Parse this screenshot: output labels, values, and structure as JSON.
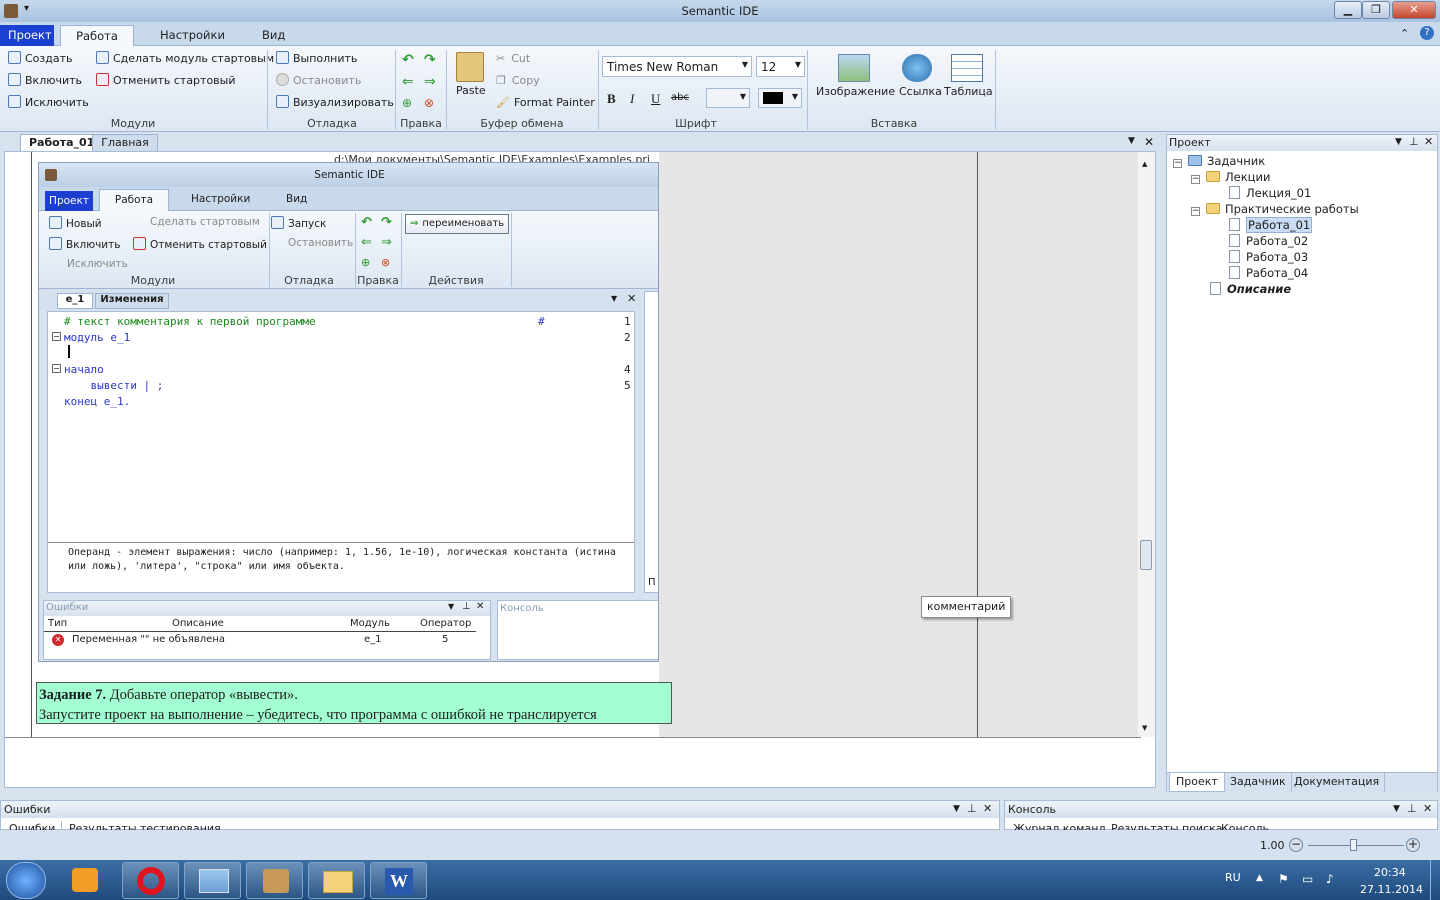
{
  "window": {
    "title": "Semantic IDE",
    "minimize": "▁",
    "maximize": "❐",
    "close": "✕"
  },
  "menu": {
    "project": "Проект",
    "tabs": [
      "Работа",
      "Настройки",
      "Вид"
    ]
  },
  "ribbon": {
    "modules": {
      "create": "Создать",
      "include": "Включить",
      "exclude": "Исключить",
      "make_start": "Сделать модуль стартовым",
      "cancel_start": "Отменить стартовый",
      "label": "Модули"
    },
    "debug": {
      "run": "Выполнить",
      "stop": "Остановить",
      "visualize": "Визуализировать",
      "label": "Отладка"
    },
    "edit": {
      "label": "Правка"
    },
    "clipboard": {
      "paste": "Paste",
      "cut": "Cut",
      "copy": "Copy",
      "format_painter": "Format Painter",
      "label": "Буфер обмена"
    },
    "font": {
      "name": "Times New Roman",
      "size": "12",
      "bold": "B",
      "italic": "I",
      "underline": "U",
      "strike": "abc",
      "label": "Шрифт"
    },
    "insert": {
      "image": "Изображение",
      "link": "Ссылка",
      "table": "Таблица",
      "label": "Вставка"
    }
  },
  "doc_tabs": [
    "Работа_01",
    "Главная"
  ],
  "path_line": "d:\\Мои документы\\Semantic IDE\\Examples\\Examples.pri",
  "inner": {
    "title": "Semantic IDE",
    "menu": {
      "project": "Проект",
      "tabs": [
        "Работа",
        "Настройки",
        "Вид"
      ]
    },
    "ribbon": {
      "new": "Новый",
      "make_start": "Сделать стартовым",
      "include": "Включить",
      "cancel_start": "Отменить стартовый",
      "exclude": "Исключить",
      "modules_label": "Модули",
      "run": "Запуск",
      "stop": "Остановить",
      "debug_label": "Отладка",
      "edit_label": "Правка",
      "rename": "переименовать",
      "actions_label": "Действия"
    },
    "editor_tabs": [
      "e_1",
      "Изменения"
    ],
    "code_lines": [
      {
        "text": "# текст комментария к первой программе",
        "num": "1"
      },
      {
        "text": "модуль e_1",
        "num": "2"
      },
      {
        "text": "",
        "num": ""
      },
      {
        "text": "начало",
        "num": "4"
      },
      {
        "text": "    вывести | ;",
        "num": "5"
      },
      {
        "text": "конец e_1.",
        "num": ""
      }
    ],
    "hash_end": "#",
    "hint": "Операнд - элемент выражения: число (например: 1, 1.56, 1e-10), логическая константа (истина или  ложь), 'литера', \"строка\" или имя объекта.",
    "side_letter": "П",
    "errors": {
      "title": "Ошибки",
      "cols": [
        "Тип",
        "Описание",
        "Модуль",
        "Оператор"
      ],
      "row": {
        "desc": "Переменная \"\" не объявлена",
        "module": "e_1",
        "op": "5"
      }
    },
    "console_title": "Консоль"
  },
  "task": {
    "bold": "Задание 7.",
    "text1": " Добавьте оператор «вывести».",
    "text2": "Запустите проект на выполнение – убедитесь, что программа с ошибкой не транслируется"
  },
  "callout": "комментарий",
  "project_panel": {
    "title": "Проект",
    "tree": {
      "root": "Задачник",
      "lectures": "Лекции",
      "lecture1": "Лекция_01",
      "practical": "Практические работы",
      "works": [
        "Работа_01",
        "Работа_02",
        "Работа_03",
        "Работа_04"
      ],
      "description": "Описание"
    },
    "tabs": [
      "Проект",
      "Задачник",
      "Документация"
    ]
  },
  "bottom": {
    "errors": "Ошибки",
    "errors_tabs": [
      "Ошибки",
      "Результаты тестирования"
    ],
    "console": "Консоль",
    "console_tabs": [
      "Журнал команд",
      "Результаты поиска",
      "Консоль"
    ]
  },
  "status": {
    "zoom": "1.00"
  },
  "taskbar": {
    "lang": "RU",
    "time": "20:34",
    "date": "27.11.2014"
  }
}
